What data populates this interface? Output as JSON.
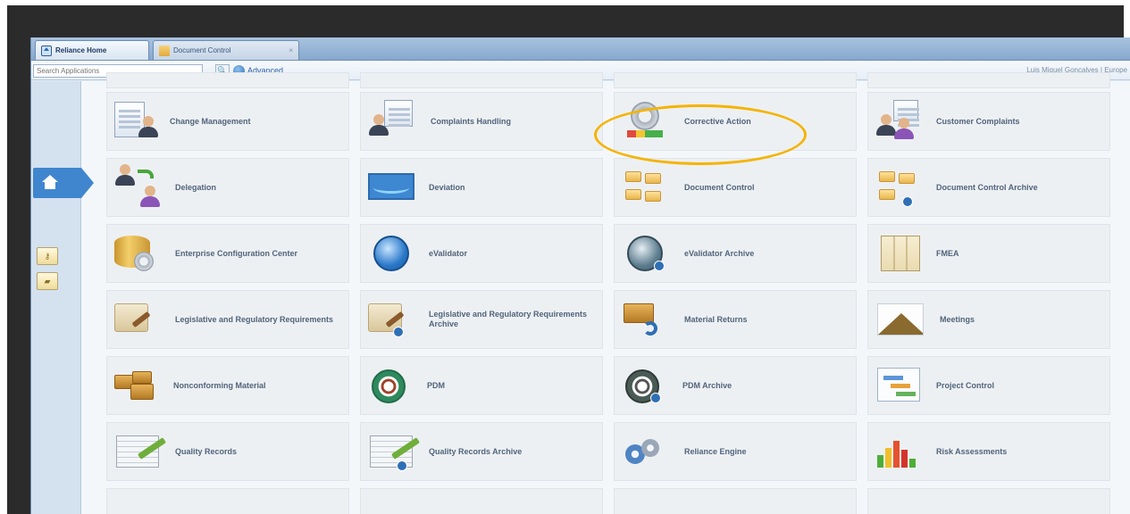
{
  "tabs": [
    {
      "label": "Reliance Home",
      "icon": "home-icon",
      "active": true
    },
    {
      "label": "Document Control",
      "icon": "folder-icon",
      "active": false,
      "close": "×"
    }
  ],
  "search": {
    "placeholder": "Search Applications",
    "value": "Search Applications...",
    "search_button": "🔍",
    "advanced_label": "Advanced"
  },
  "user": {
    "name": "Luis Miguel Goncalves | Europe"
  },
  "sidebar": {
    "items": [
      {
        "icon": "home-icon",
        "active": true
      },
      {
        "icon": "key-icon",
        "label": "⚷"
      },
      {
        "icon": "folder-icon",
        "label": "▰"
      }
    ]
  },
  "apps": [
    {
      "label": "Change Management",
      "icon": "change-management-icon"
    },
    {
      "label": "Complaints Handling",
      "icon": "complaints-handling-icon"
    },
    {
      "label": "Corrective Action",
      "icon": "corrective-action-icon",
      "highlighted": true
    },
    {
      "label": "Customer Complaints",
      "icon": "customer-complaints-icon"
    },
    {
      "label": "Delegation",
      "icon": "delegation-icon"
    },
    {
      "label": "Deviation",
      "icon": "deviation-icon"
    },
    {
      "label": "Document Control",
      "icon": "document-control-icon"
    },
    {
      "label": "Document Control Archive",
      "icon": "document-control-archive-icon"
    },
    {
      "label": "Enterprise Configuration Center",
      "icon": "enterprise-configuration-icon"
    },
    {
      "label": "eValidator",
      "icon": "evalidator-icon"
    },
    {
      "label": "eValidator Archive",
      "icon": "evalidator-archive-icon"
    },
    {
      "label": "FMEA",
      "icon": "fmea-icon"
    },
    {
      "label": "Legislative and Regulatory Requirements",
      "icon": "legislative-icon"
    },
    {
      "label": "Legislative and Regulatory Requirements Archive",
      "icon": "legislative-archive-icon"
    },
    {
      "label": "Material Returns",
      "icon": "material-returns-icon"
    },
    {
      "label": "Meetings",
      "icon": "meetings-icon"
    },
    {
      "label": "Nonconforming Material",
      "icon": "nonconforming-material-icon"
    },
    {
      "label": "PDM",
      "icon": "pdm-icon"
    },
    {
      "label": "PDM Archive",
      "icon": "pdm-archive-icon"
    },
    {
      "label": "Project Control",
      "icon": "project-control-icon"
    },
    {
      "label": "Quality Records",
      "icon": "quality-records-icon"
    },
    {
      "label": "Quality Records Archive",
      "icon": "quality-records-archive-icon"
    },
    {
      "label": "Reliance Engine",
      "icon": "reliance-engine-icon"
    },
    {
      "label": "Risk Assessments",
      "icon": "risk-assessments-icon"
    }
  ],
  "colors": {
    "highlight": "#f4b400",
    "accent": "#3f86cf",
    "tile_bg": "#edf0f3",
    "label_text": "#51647c"
  }
}
